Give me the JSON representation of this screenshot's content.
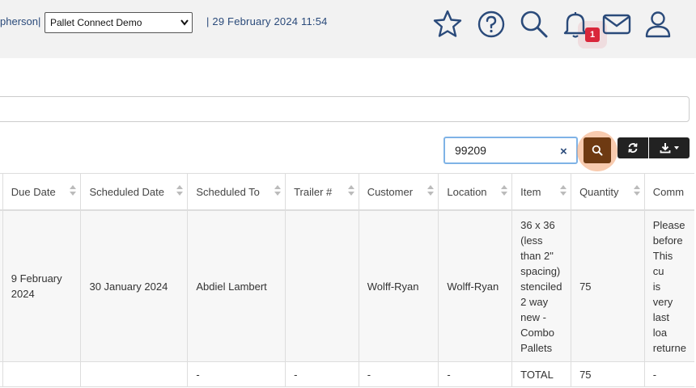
{
  "header": {
    "user_fragment": "pherson",
    "separator": "|",
    "company_select": "Pallet Connect Demo",
    "datetime": "| 29 February 2024 11:54",
    "notification_count": "1",
    "icons": [
      "star-icon",
      "help-icon",
      "search-icon",
      "bell-icon",
      "mail-icon",
      "user-icon"
    ]
  },
  "toolbar": {
    "search_value": "99209",
    "clear_label": "×"
  },
  "colors": {
    "accent_blue": "#2a4a7a",
    "search_button": "#6e3a12",
    "badge": "#d9263a"
  },
  "table": {
    "columns": [
      "Due Date",
      "Scheduled Date",
      "Scheduled To",
      "Trailer #",
      "Customer",
      "Location",
      "Item",
      "Quantity",
      "Comm"
    ],
    "rows": [
      [
        "9 February 2024",
        "30 January 2024",
        "Abdiel Lambert",
        "",
        "Wolff-Ryan",
        "Wolff-Ryan",
        "36 x 36 (less than 2\" spacing) stenciled 2 way new - Combo Pallets",
        "75",
        "Please before This cu is very last loa returne"
      ],
      [
        "",
        "",
        "-",
        "-",
        "-",
        "-",
        "TOTAL",
        "75",
        "-"
      ]
    ]
  }
}
